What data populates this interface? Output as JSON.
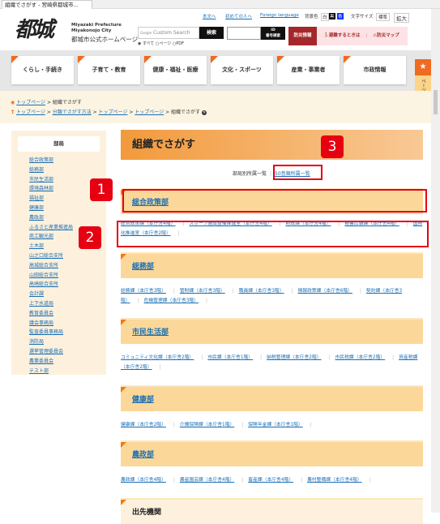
{
  "browser": {
    "tab_title": "組織でさがす - 宮崎県都城市..."
  },
  "header": {
    "logo_text": "都城",
    "pref": "Miyazaki Prefecture",
    "city": "Miyakonojo City",
    "site_name": "都城市公式ホームページ",
    "links": [
      "本文へ",
      "初めての人へ",
      "Foreign language"
    ],
    "bg_label": "背景色",
    "bg_options": [
      "白",
      "黒",
      "青"
    ],
    "font_label": "文字サイズ",
    "font_options": [
      "標準",
      "拡大"
    ],
    "search_placeholder": "Custom Search",
    "search_brand": "Google",
    "search_button": "検索",
    "search_scopes": [
      "すべて",
      "ページ",
      "PDF"
    ],
    "id_button": "ID\n番号検索",
    "bousai": "防災情報",
    "hinan": "避難するときは",
    "bousai_map": "防災マップ"
  },
  "nav": [
    "くらし・手続き",
    "子育て・教育",
    "健康・福祉・医療",
    "文化・スポーツ",
    "産業・事業者",
    "市政情報"
  ],
  "save_page": "ページを一時保存",
  "breadcrumb1": [
    "トップページ",
    "組織でさがす"
  ],
  "breadcrumb2": [
    "トップページ",
    "分類でさがす方法",
    "トップページ",
    "トップページ",
    "組織でさがす"
  ],
  "sidebar": {
    "title": "部局",
    "items": [
      "総合政策部",
      "総務部",
      "市民生活部",
      "環境森林部",
      "福祉部",
      "健康部",
      "農政部",
      "ふるさと産業推進局",
      "商工観光部",
      "土木部",
      "山之口総合支所",
      "高城総合支所",
      "山田総合支所",
      "高崎総合支所",
      "会計課",
      "上下水道局",
      "教育委員会",
      "議会事務局",
      "監査委員事務局",
      "消防局",
      "選挙管理委員会",
      "農業委員会",
      "テスト部"
    ]
  },
  "main": {
    "title": "組織でさがす",
    "tab_current": "部局別所属一覧",
    "tab_link": "50音順所属一覧",
    "sections": [
      {
        "name": "総合政策部",
        "links": [
          "総合政策課（本庁舎4階）",
          "スポーツ施設整備推進室（本庁舎4階）",
          "財政課（本庁舎4階）",
          "秘書広報課（本庁舎4階）",
          "国際化推進室（本庁舎2階）"
        ]
      },
      {
        "name": "総務部",
        "links": [
          "総務課（本庁舎3階）",
          "管財課（本庁舎3階）",
          "職員課（本庁舎3階）",
          "情報政策課（本庁舎6階）",
          "契約課（本庁舎3階）",
          "危機管理課（本庁舎3階）"
        ]
      },
      {
        "name": "市民生活部",
        "links": [
          "コミュニティ文化課（本庁舎2階）",
          "市民課（本庁舎1階）",
          "納税管理課（本庁舎2階）",
          "市民税課（本庁舎2階）",
          "資産税課（本庁舎2階）"
        ]
      },
      {
        "name": "健康部",
        "links": [
          "健康課（本庁舎2階）",
          "介護保険課（本庁舎1階）",
          "保険年金課（本庁舎1階）"
        ]
      },
      {
        "name": "農政部",
        "links": [
          "農政課（本庁舎4階）",
          "農産園芸課（本庁舎4階）",
          "畜産課（本庁舎4階）",
          "農村整備課（本庁舎4階）"
        ]
      }
    ],
    "outpost": "出先機関"
  },
  "annotations": [
    "1",
    "2",
    "3"
  ],
  "colors": {
    "accent": "#f06a1f",
    "section_bg": "#fbd899",
    "annotation": "#e60012",
    "link": "#1a6fb5"
  }
}
